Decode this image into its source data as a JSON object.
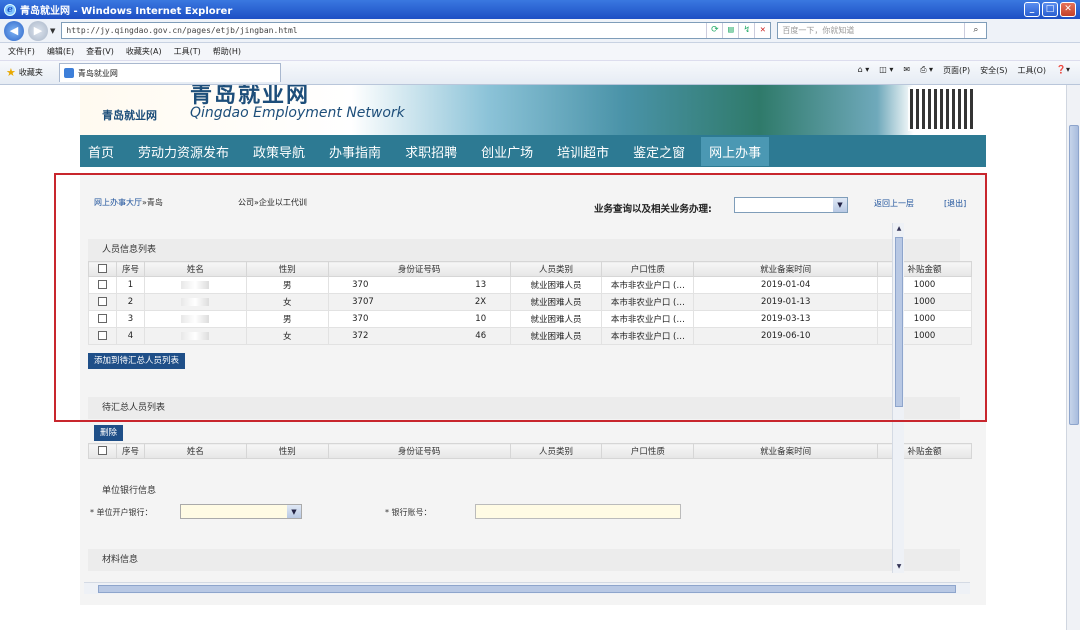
{
  "window": {
    "title": "青岛就业网 - Windows Internet Explorer",
    "url": "http://jy.qingdao.gov.cn/pages/etjb/jingban.html",
    "search_placeholder": "百度一下，你就知道"
  },
  "menu": [
    "文件(F)",
    "编辑(E)",
    "查看(V)",
    "收藏夹(A)",
    "工具(T)",
    "帮助(H)"
  ],
  "favorites": {
    "label": "收藏夹",
    "tab_title": "青岛就业网",
    "commands": [
      "页面(P)",
      "安全(S)",
      "工具(O)"
    ]
  },
  "site": {
    "logo_cn": "青岛就业网",
    "logo_en": "Qingdao Employment Network",
    "logo_big": "青岛就业网",
    "nav": [
      "首页",
      "劳动力资源发布",
      "政策导航",
      "办事指南",
      "求职招聘",
      "创业广场",
      "培训超市",
      "鉴定之窗",
      "网上办事"
    ]
  },
  "main": {
    "breadcrumb": {
      "hall": "网上办事大厅",
      "sep": "»",
      "city": "青岛",
      "company": "公司",
      "service": "»企业以工代训"
    },
    "biz_label": "业务查询以及相关业务办理:",
    "back_link": "返回上一层",
    "exit_link": "[退出]",
    "staff_title": "人员信息列表",
    "pending_title": "待汇总人员列表",
    "add_button": "添加到待汇总人员列表",
    "delete_button": "删除",
    "bank_title": "单位银行信息",
    "bank_open_label": "* 单位开户银行：",
    "bank_account_label": "* 银行账号：",
    "material_title": "材料信息"
  },
  "table": {
    "columns": [
      "序号",
      "姓名",
      "性别",
      "身份证号码",
      "人员类别",
      "户口性质",
      "就业备案时间",
      "补贴金额"
    ],
    "rows": [
      {
        "no": "1",
        "gender": "男",
        "id_left": "370",
        "id_right": "13",
        "category": "就业困难人员",
        "hukou": "本市非农业户口 (…",
        "date": "2019-01-04",
        "amount": "1000"
      },
      {
        "no": "2",
        "gender": "女",
        "id_left": "3707",
        "id_right": "2X",
        "category": "就业困难人员",
        "hukou": "本市非农业户口 (…",
        "date": "2019-01-13",
        "amount": "1000"
      },
      {
        "no": "3",
        "gender": "男",
        "id_left": "370",
        "id_right": "10",
        "category": "就业困难人员",
        "hukou": "本市非农业户口 (…",
        "date": "2019-03-13",
        "amount": "1000"
      },
      {
        "no": "4",
        "gender": "女",
        "id_left": "372",
        "id_right": "46",
        "category": "就业困难人员",
        "hukou": "本市非农业户口 (…",
        "date": "2019-06-10",
        "amount": "1000"
      }
    ]
  },
  "colors": {
    "nav_bg": "#2d7a93",
    "button_bg": "#1f4f88",
    "highlight_border": "#c8262d"
  }
}
